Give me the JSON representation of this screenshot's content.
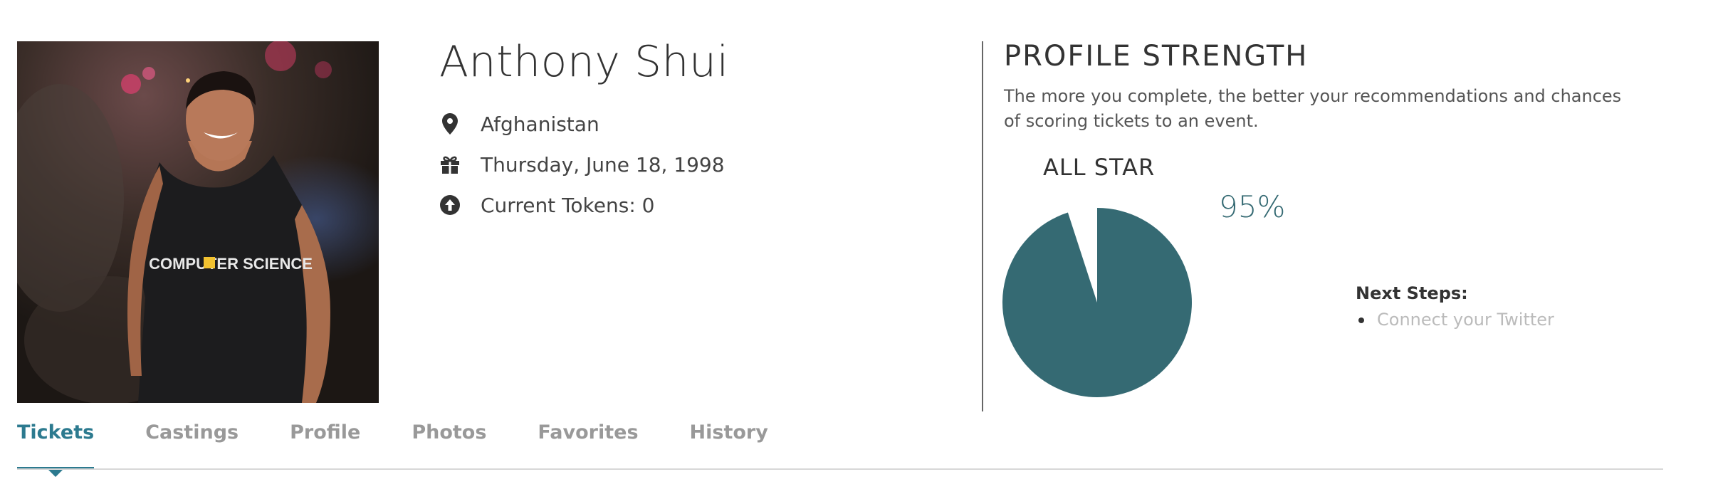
{
  "profile": {
    "name": "Anthony Shui",
    "location": "Afghanistan",
    "birthday": "Thursday, June 18, 1998",
    "tokens": "Current Tokens: 0",
    "photo_shirt_text": "COMPUTER SCIENCE",
    "icons": {
      "location": "map-pin-icon",
      "birthday": "gift-icon",
      "tokens": "arrow-up-circle-icon"
    }
  },
  "strength": {
    "title": "PROFILE STRENGTH",
    "description": "The more you complete, the better your recommendations and chances of scoring tickets to an event.",
    "level": "ALL STAR",
    "percent_label": "95%",
    "percent_value": 95,
    "next_steps_title": "Next Steps:",
    "next_steps": [
      "Connect your Twitter"
    ]
  },
  "colors": {
    "accent": "#2c7a8f",
    "pie": "#356a73",
    "muted_text": "#bbbbbb",
    "tab_inactive": "#999999"
  },
  "tabs": [
    {
      "label": "Tickets",
      "active": true
    },
    {
      "label": "Castings",
      "active": false
    },
    {
      "label": "Profile",
      "active": false
    },
    {
      "label": "Photos",
      "active": false
    },
    {
      "label": "Favorites",
      "active": false
    },
    {
      "label": "History",
      "active": false
    }
  ]
}
